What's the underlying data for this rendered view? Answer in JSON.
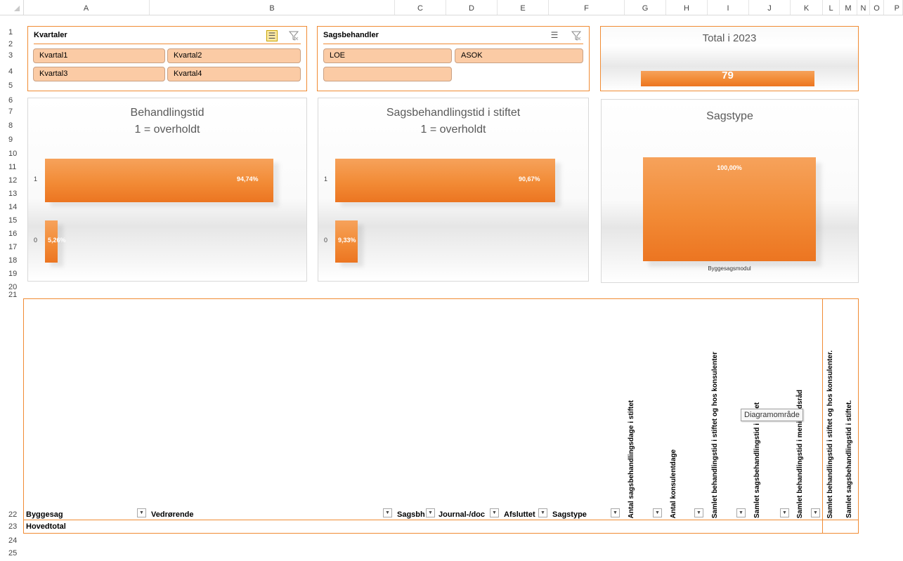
{
  "columns": [
    "A",
    "B",
    "C",
    "D",
    "E",
    "F",
    "G",
    "H",
    "I",
    "J",
    "K",
    "L",
    "M",
    "N",
    "O",
    "P"
  ],
  "rows": [
    "1",
    "2",
    "3",
    "4",
    "5",
    "6",
    "7",
    "8",
    "9",
    "10",
    "11",
    "12",
    "13",
    "14",
    "15",
    "16",
    "17",
    "18",
    "19",
    "20",
    "21",
    "22",
    "23",
    "24",
    "25"
  ],
  "slicers": {
    "kvartaler": {
      "title": "Kvartaler",
      "items": [
        "Kvartal1",
        "Kvartal2",
        "Kvartal3",
        "Kvartal4"
      ]
    },
    "sagsbehandler": {
      "title": "Sagsbehandler",
      "items": [
        "LOE",
        "ASOK",
        ""
      ]
    }
  },
  "total": {
    "title": "Total i 2023",
    "value": "79",
    "accent": "#f28b36"
  },
  "charts": [
    {
      "title_line1": "Behandlingstid",
      "title_line2": "1 = overholdt",
      "chart_data": {
        "type": "bar",
        "orientation": "horizontal",
        "categories": [
          "1",
          "0"
        ],
        "values": [
          94.74,
          5.26
        ],
        "labels": [
          "94,74%",
          "5,26%"
        ],
        "xlim": [
          0,
          100
        ]
      }
    },
    {
      "title_line1": "Sagsbehandlingstid i stiftet",
      "title_line2": "1 = overholdt",
      "chart_data": {
        "type": "bar",
        "orientation": "horizontal",
        "categories": [
          "1",
          "0"
        ],
        "values": [
          90.67,
          9.33
        ],
        "labels": [
          "90,67%",
          "9,33%"
        ],
        "xlim": [
          0,
          100
        ]
      }
    },
    {
      "title_line1": "Sagstype",
      "chart_data": {
        "type": "bar",
        "orientation": "vertical",
        "categories": [
          "Byggesagsmodul"
        ],
        "values": [
          100
        ],
        "labels": [
          "100,00%"
        ],
        "ylim": [
          0,
          100
        ]
      }
    }
  ],
  "pivot": {
    "headers": [
      "Byggesag",
      "Vedrørende",
      "Sagsbh",
      "Journal-/doc",
      "Afsluttet",
      "Sagstype"
    ],
    "vertical_headers": [
      "Antal sagsbehandlingsdage i stiftet",
      "Antal konsulentdage",
      "Samlet behandlingstid i stiftet og hos konsulenter",
      "Samlet sagsbehandlingstid i stiftet",
      "Samlet behandlingstid i menighedsråd",
      "Samlet behandlingstid i stiftet og hos konsulenter.",
      "Samlet sagsbehandlingstid i stiftet."
    ],
    "total_label": "Hovedtotal"
  },
  "tooltip": "Diagramområde"
}
